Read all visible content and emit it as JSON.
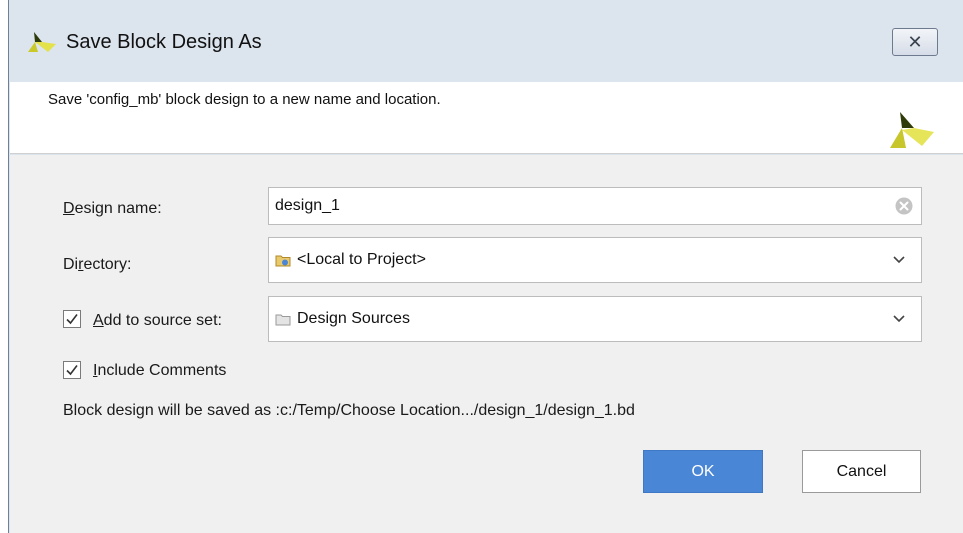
{
  "dialog": {
    "title": "Save Block Design As",
    "close_symbol": "✕",
    "description": "Save 'config_mb' block design to a new name and location."
  },
  "form": {
    "design_name": {
      "label_mnemonic": "D",
      "label_rest": "esign name:",
      "value": "design_1"
    },
    "directory": {
      "label_pre": "Di",
      "label_mnemonic": "r",
      "label_rest": "ectory:",
      "value": "<Local to Project>"
    },
    "add_to_source_set": {
      "checked": true,
      "label_mnemonic": "A",
      "label_rest": "dd to source set:",
      "value": "Design Sources"
    },
    "include_comments": {
      "checked": true,
      "label_mnemonic": "I",
      "label_rest": "nclude Comments"
    },
    "save_path_text": "Block design will be saved as :c:/Temp/Choose Location.../design_1/design_1.bd"
  },
  "buttons": {
    "ok": "OK",
    "cancel": "Cancel"
  },
  "icons": {
    "title": "vivado-logo-icon",
    "header": "vivado-logo-icon",
    "directory": "project-folder-icon",
    "source_set": "folder-icon",
    "clear": "clear-icon",
    "dropdown": "chevron-down-icon"
  },
  "colors": {
    "ok_button": "#4a86d6",
    "title_bar": "#dce4ee",
    "logo_yellow": "#d8d832",
    "logo_dark": "#2f3b08"
  }
}
